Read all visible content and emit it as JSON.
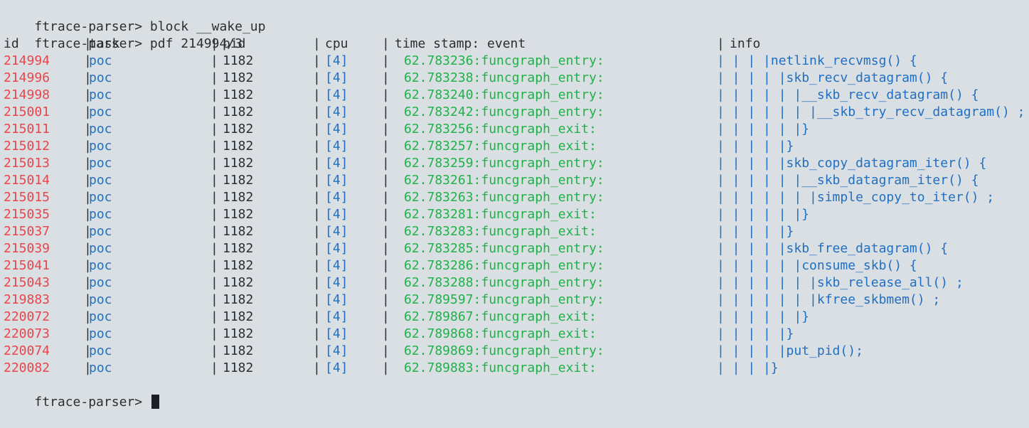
{
  "colors": {
    "background": "#d9dfe2",
    "text": "#2b2f33",
    "id": "#e9454b",
    "task_cpu_info": "#1f6fc4",
    "event": "#20b14a"
  },
  "history": [
    {
      "prompt": "ftrace-parser>",
      "command": "block __wake_up"
    },
    {
      "prompt": "ftrace-parser>",
      "command": "pdf 214994/3"
    }
  ],
  "headers": {
    "id": "id",
    "task": "task",
    "pid": "pid",
    "cpu": "cpu",
    "event": "time stamp: event",
    "info": "info"
  },
  "rows": [
    {
      "id": "214994",
      "task": "poc",
      "pid": "1182",
      "cpu": "[4]",
      "event": "62.783236:funcgraph_entry:",
      "info": "| | | |netlink_recvmsg() {"
    },
    {
      "id": "214996",
      "task": "poc",
      "pid": "1182",
      "cpu": "[4]",
      "event": "62.783238:funcgraph_entry:",
      "info": "| | | | |skb_recv_datagram() {"
    },
    {
      "id": "214998",
      "task": "poc",
      "pid": "1182",
      "cpu": "[4]",
      "event": "62.783240:funcgraph_entry:",
      "info": "| | | | | |__skb_recv_datagram() {"
    },
    {
      "id": "215001",
      "task": "poc",
      "pid": "1182",
      "cpu": "[4]",
      "event": "62.783242:funcgraph_entry:",
      "info": "| | | | | | |__skb_try_recv_datagram() ;"
    },
    {
      "id": "215011",
      "task": "poc",
      "pid": "1182",
      "cpu": "[4]",
      "event": "62.783256:funcgraph_exit:",
      "info": "| | | | | |}"
    },
    {
      "id": "215012",
      "task": "poc",
      "pid": "1182",
      "cpu": "[4]",
      "event": "62.783257:funcgraph_exit:",
      "info": "| | | | |}"
    },
    {
      "id": "215013",
      "task": "poc",
      "pid": "1182",
      "cpu": "[4]",
      "event": "62.783259:funcgraph_entry:",
      "info": "| | | | |skb_copy_datagram_iter() {"
    },
    {
      "id": "215014",
      "task": "poc",
      "pid": "1182",
      "cpu": "[4]",
      "event": "62.783261:funcgraph_entry:",
      "info": "| | | | | |__skb_datagram_iter() {"
    },
    {
      "id": "215015",
      "task": "poc",
      "pid": "1182",
      "cpu": "[4]",
      "event": "62.783263:funcgraph_entry:",
      "info": "| | | | | | |simple_copy_to_iter() ;"
    },
    {
      "id": "215035",
      "task": "poc",
      "pid": "1182",
      "cpu": "[4]",
      "event": "62.783281:funcgraph_exit:",
      "info": "| | | | | |}"
    },
    {
      "id": "215037",
      "task": "poc",
      "pid": "1182",
      "cpu": "[4]",
      "event": "62.783283:funcgraph_exit:",
      "info": "| | | | |}"
    },
    {
      "id": "215039",
      "task": "poc",
      "pid": "1182",
      "cpu": "[4]",
      "event": "62.783285:funcgraph_entry:",
      "info": "| | | | |skb_free_datagram() {"
    },
    {
      "id": "215041",
      "task": "poc",
      "pid": "1182",
      "cpu": "[4]",
      "event": "62.783286:funcgraph_entry:",
      "info": "| | | | | |consume_skb() {"
    },
    {
      "id": "215043",
      "task": "poc",
      "pid": "1182",
      "cpu": "[4]",
      "event": "62.783288:funcgraph_entry:",
      "info": "| | | | | | |skb_release_all() ;"
    },
    {
      "id": "219883",
      "task": "poc",
      "pid": "1182",
      "cpu": "[4]",
      "event": "62.789597:funcgraph_entry:",
      "info": "| | | | | | |kfree_skbmem() ;"
    },
    {
      "id": "220072",
      "task": "poc",
      "pid": "1182",
      "cpu": "[4]",
      "event": "62.789867:funcgraph_exit:",
      "info": "| | | | | |}"
    },
    {
      "id": "220073",
      "task": "poc",
      "pid": "1182",
      "cpu": "[4]",
      "event": "62.789868:funcgraph_exit:",
      "info": "| | | | |}"
    },
    {
      "id": "220074",
      "task": "poc",
      "pid": "1182",
      "cpu": "[4]",
      "event": "62.789869:funcgraph_entry:",
      "info": "| | | | |put_pid();"
    },
    {
      "id": "220082",
      "task": "poc",
      "pid": "1182",
      "cpu": "[4]",
      "event": "62.789883:funcgraph_exit:",
      "info": "| | | |}"
    }
  ],
  "prompt": {
    "text": "ftrace-parser>"
  }
}
